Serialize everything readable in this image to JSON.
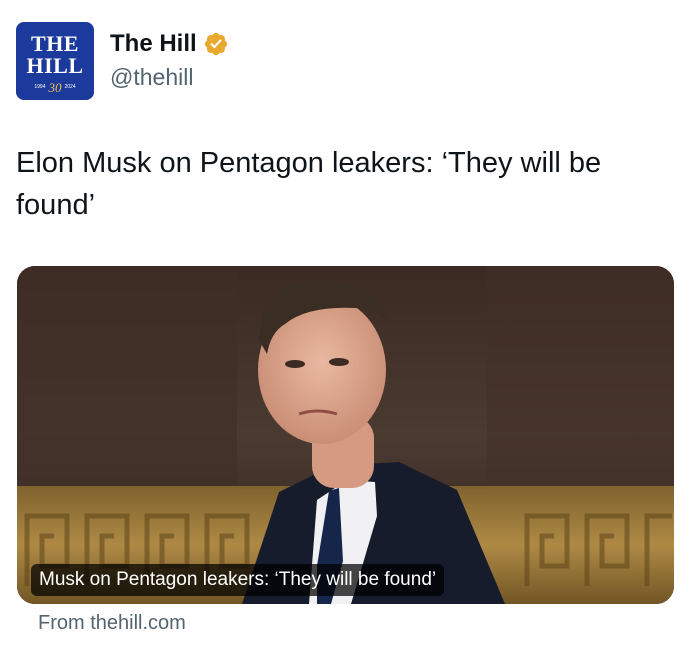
{
  "account": {
    "display_name": "The Hill",
    "handle": "@thehill",
    "verified": true,
    "verified_badge_color": "#e8a92c",
    "avatar": {
      "logo_line1": "THE",
      "logo_line2": "HILL",
      "year_start": "1994",
      "anniversary": "30",
      "year_end": "2024",
      "background_color": "#1b3a9c"
    }
  },
  "post": {
    "text": "Elon Musk on Pentagon leakers: ‘They will be found’"
  },
  "link_card": {
    "caption": "Musk on Pentagon leakers: ‘They will be found’",
    "source": "From thehill.com"
  }
}
